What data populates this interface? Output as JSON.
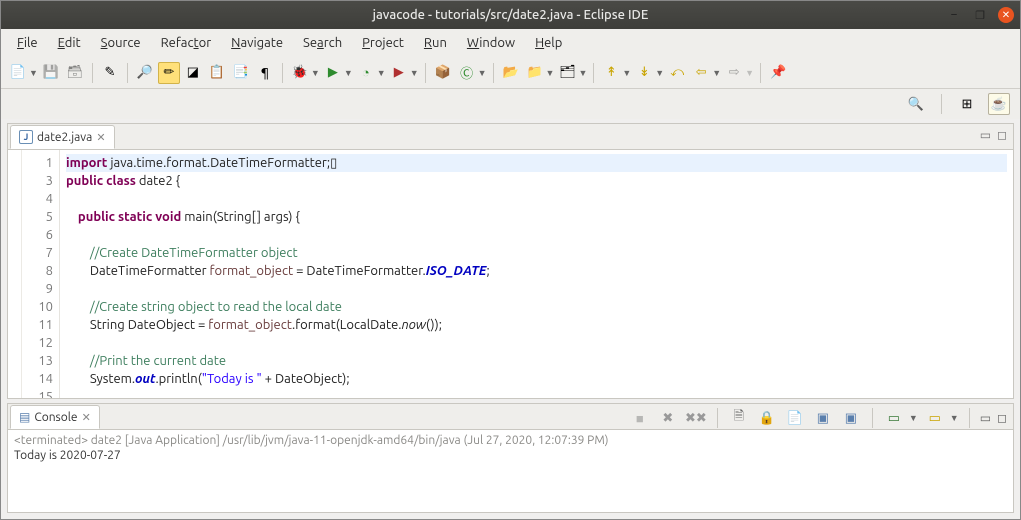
{
  "window": {
    "title": "javacode - tutorials/src/date2.java - Eclipse IDE"
  },
  "menu": {
    "file": "File",
    "edit": "Edit",
    "source": "Source",
    "refactor": "Refactor",
    "navigate": "Navigate",
    "search": "Search",
    "project": "Project",
    "run": "Run",
    "window": "Window",
    "help": "Help"
  },
  "editor": {
    "tab_label": "date2.java",
    "lines": {
      "l1": "import java.time.format.DateTimeFormatter;",
      "l3": "public class date2 {",
      "l4": "",
      "l5": "    public static void main(String[] args) {",
      "l6": "",
      "l7": "        //Create DateTimeFormatter object",
      "l8a": "        DateTimeFormatter ",
      "l8b": "format_object",
      "l8c": " = DateTimeFormatter.",
      "l8d": "ISO_DATE",
      "l8e": ";",
      "l9": "",
      "l10": "        //Create string object to read the local date",
      "l11a": "        String DateObject = ",
      "l11b": "format_object",
      "l11c": ".format(LocalDate.",
      "l11d": "now",
      "l11e": "());",
      "l12": "",
      "l13": "        //Print the current date",
      "l14a": "        System.",
      "l14b": "out",
      "l14c": ".println(",
      "l14d": "\"Today is \"",
      "l14e": " + DateObject);",
      "l15": ""
    },
    "gutter": "1\n3\n4\n5\n6\n7\n8\n9\n10\n11\n12\n13\n14\n15"
  },
  "console": {
    "tab_label": "Console",
    "header": "<terminated> date2 [Java Application] /usr/lib/jvm/java-11-openjdk-amd64/bin/java (Jul 27, 2020, 12:07:39 PM)",
    "output": "Today is 2020-07-27"
  }
}
